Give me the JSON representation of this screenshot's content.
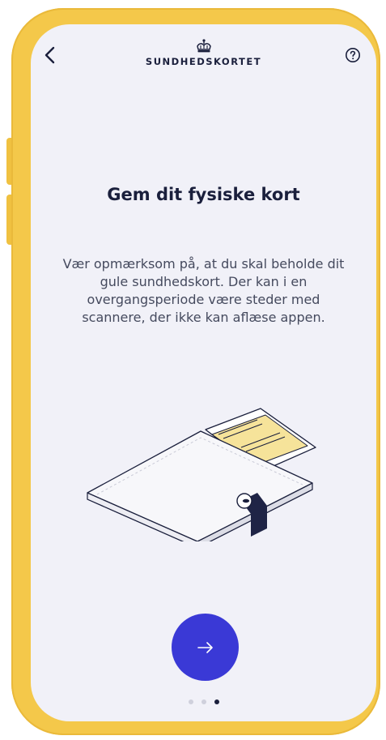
{
  "header": {
    "brand_name": "SUNDHEDSKORTET",
    "back_icon": "chevron-left-icon",
    "help_icon": "question-circle-icon",
    "logo_icon": "crown-icon"
  },
  "onboarding": {
    "title": "Gem dit fysiske kort",
    "body": "Vær opmærksom på, at du skal beholde dit gule sundhedskort. Der kan i en overgangsperiode være steder med scannere, der ikke kan aflæse appen.",
    "illustration": "wallet-with-health-card-illustration"
  },
  "navigation": {
    "next_icon": "arrow-right-icon",
    "pager": {
      "total": 3,
      "current": 3
    }
  },
  "colors": {
    "frame": "#f4c84a",
    "screen_background": "#f1f1f8",
    "accent": "#3a39d6",
    "text_dark": "#1a1f3c",
    "card_yellow": "#f6e39a"
  }
}
